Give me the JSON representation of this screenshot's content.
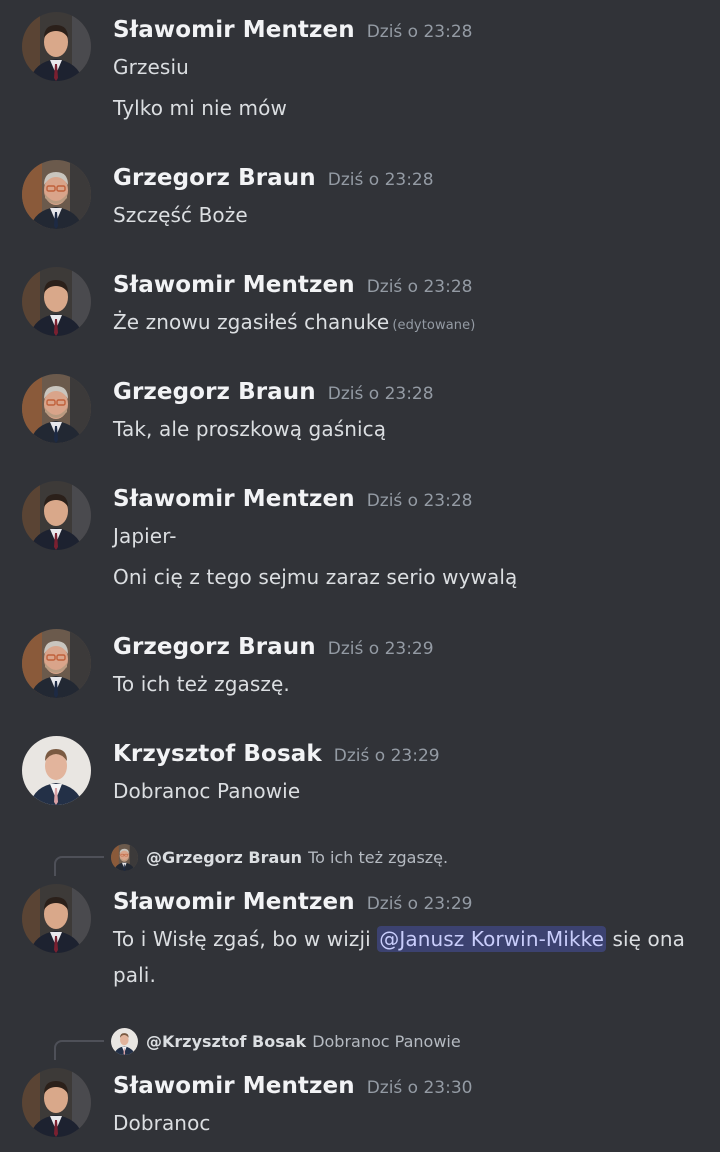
{
  "messages": [
    {
      "author": "Sławomir Mentzen",
      "time": "Dziś o 23:28",
      "avatar": "mentzen",
      "lines": [
        "Grzesiu",
        "Tylko mi nie mów"
      ]
    },
    {
      "author": "Grzegorz Braun",
      "time": "Dziś o 23:28",
      "avatar": "braun",
      "lines": [
        "Szczęść Boże"
      ]
    },
    {
      "author": "Sławomir Mentzen",
      "time": "Dziś o 23:28",
      "avatar": "mentzen",
      "lines": [
        "Że znowu zgasiłeś chanuke"
      ],
      "edited": "(edytowane)"
    },
    {
      "author": "Grzegorz Braun",
      "time": "Dziś o 23:28",
      "avatar": "braun",
      "lines": [
        "Tak, ale proszkową gaśnicą"
      ]
    },
    {
      "author": "Sławomir Mentzen",
      "time": "Dziś o 23:28",
      "avatar": "mentzen",
      "lines": [
        "Japier-",
        "Oni cię z tego sejmu zaraz serio wywalą"
      ]
    },
    {
      "author": "Grzegorz Braun",
      "time": "Dziś o 23:29",
      "avatar": "braun",
      "lines": [
        "To ich też zgaszę."
      ]
    },
    {
      "author": "Krzysztof Bosak",
      "time": "Dziś o 23:29",
      "avatar": "bosak",
      "lines": [
        "Dobranoc Panowie"
      ]
    },
    {
      "author": "Sławomir Mentzen",
      "time": "Dziś o 23:29",
      "avatar": "mentzen",
      "reply": {
        "user": "@Grzegorz Braun",
        "text": "To ich też zgaszę.",
        "avatar": "braun"
      },
      "segments": {
        "before": "To i Wisłę zgaś, bo w wizji ",
        "mention": "@Janusz Korwin-Mikke",
        "after": " się ona",
        "line2": "pali."
      }
    },
    {
      "author": "Sławomir Mentzen",
      "time": "Dziś o 23:30",
      "avatar": "mentzen",
      "reply": {
        "user": "@Krzysztof Bosak",
        "text": "Dobranoc Panowie",
        "avatar": "bosak"
      },
      "lines": [
        "Dobranoc"
      ]
    }
  ],
  "colors": {
    "background": "#313338",
    "name": "#f2f3f5",
    "text": "#dbdee1",
    "muted": "#949ba4",
    "mention_bg": "#3c4270",
    "mention_text": "#c9cdfb"
  }
}
